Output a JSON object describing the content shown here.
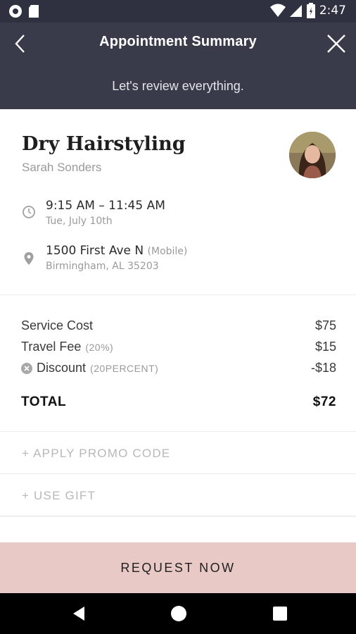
{
  "status_bar": {
    "time": "2:47",
    "icons": [
      "record-icon",
      "sd-card-icon",
      "wifi-icon",
      "cell-signal-icon",
      "battery-icon"
    ]
  },
  "header": {
    "title": "Appointment Summary",
    "subtitle": "Let's review everything.",
    "back_icon": "chevron-left-icon",
    "close_icon": "close-icon"
  },
  "service": {
    "title": "Dry Hairstyling",
    "stylist": "Sarah Sonders",
    "time_range": "9:15 AM – 11:45 AM",
    "date": "Tue, July 10th",
    "address_line": "1500 First Ave N",
    "address_tag": "(Mobile)",
    "city_line": "Birmingham, AL 35203"
  },
  "costs": {
    "service_label": "Service Cost",
    "service_value": "$75",
    "travel_label": "Travel Fee",
    "travel_note": "(20%)",
    "travel_value": "$15",
    "discount_label": "Discount",
    "discount_note": "(20PERCENT)",
    "discount_value": "-$18",
    "total_label": "TOTAL",
    "total_value": "$72"
  },
  "actions": {
    "promo_label": "+ APPLY PROMO CODE",
    "gift_label": "+ USE GIFT"
  },
  "cta": {
    "request_label": "REQUEST NOW"
  },
  "colors": {
    "header_bg": "#393a4a",
    "cta_bg": "#e8c9c6",
    "muted_text": "#9a9a9a"
  }
}
